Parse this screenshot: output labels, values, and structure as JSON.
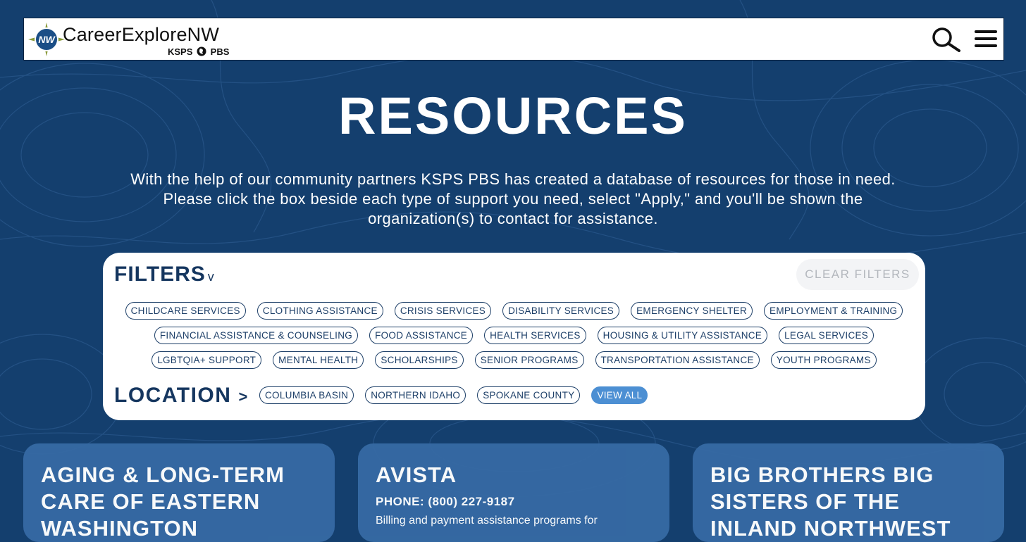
{
  "header": {
    "brand": "CareerExploreNW",
    "brand_sub_left": "KSPS",
    "brand_sub_right": "PBS",
    "logo_text": "NW",
    "search_icon": "search-icon",
    "menu_icon": "hamburger-menu-icon"
  },
  "hero": {
    "title": "RESOURCES",
    "intro": "With the help of our community partners KSPS PBS has created a database of resources for those in need. Please click the box beside each type of support you need, select \"Apply,\" and you'll be shown the organization(s) to contact for assistance."
  },
  "filters": {
    "title": "FILTERS",
    "caret": "v",
    "clear_label": "CLEAR FILTERS",
    "row1": [
      "CHILDCARE SERVICES",
      "CLOTHING ASSISTANCE",
      "CRISIS SERVICES",
      "DISABILITY SERVICES",
      "EMERGENCY SHELTER",
      "EMPLOYMENT & TRAINING"
    ],
    "row2": [
      "FINANCIAL ASSISTANCE & COUNSELING",
      "FOOD ASSISTANCE",
      "HEALTH SERVICES",
      "HOUSING & UTILITY ASSISTANCE",
      "LEGAL SERVICES"
    ],
    "row3": [
      "LGBTQIA+ SUPPORT",
      "MENTAL HEALTH",
      "SCHOLARSHIPS",
      "SENIOR PROGRAMS",
      "TRANSPORTATION ASSISTANCE",
      "YOUTH PROGRAMS"
    ]
  },
  "location": {
    "title": "LOCATION",
    "arrow": ">",
    "options": [
      "COLUMBIA BASIN",
      "NORTHERN IDAHO",
      "SPOKANE COUNTY",
      "VIEW ALL"
    ],
    "selected": "VIEW ALL"
  },
  "cards": [
    {
      "title": "AGING & LONG-TERM CARE OF EASTERN WASHINGTON",
      "phone": "",
      "desc": ""
    },
    {
      "title": "AVISTA",
      "phone": "PHONE: (800) 227-9187",
      "desc": "Billing and payment assistance programs for"
    },
    {
      "title": "BIG BROTHERS BIG SISTERS OF THE INLAND NORTHWEST",
      "phone": "",
      "desc": ""
    }
  ],
  "colors": {
    "background": "#143f6e",
    "navy_text": "#15365f",
    "card": "#3669a3",
    "active_chip": "#4c8fd3"
  }
}
